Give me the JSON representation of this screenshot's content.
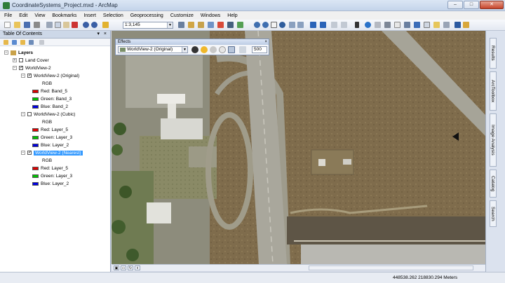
{
  "window": {
    "title": "CoordinateSystems_Project.mxd - ArcMap"
  },
  "window_controls": {
    "minimize": "–",
    "maximize": "□",
    "close": "✕"
  },
  "menu": [
    "File",
    "Edit",
    "View",
    "Bookmarks",
    "Insert",
    "Selection",
    "Geoprocessing",
    "Customize",
    "Windows",
    "Help"
  ],
  "toolbar": {
    "scale": "1:3,145",
    "dropdown_glyph": "▼"
  },
  "toc": {
    "title": "Table Of Contents",
    "header_buttons": "▾ × ",
    "tree": {
      "root": "Layers",
      "items": [
        {
          "label": "Land Cover"
        },
        {
          "label": "WorldView-2"
        }
      ],
      "sublayers": [
        {
          "label": "WorldView-2 (Original)",
          "checked": true,
          "type": "RGB",
          "bands": [
            {
              "name": "Red:",
              "value": "Band_5",
              "color": "#e00000"
            },
            {
              "name": "Green:",
              "value": "Band_3",
              "color": "#00c000"
            },
            {
              "name": "Blue:",
              "value": "Band_2",
              "color": "#0000e0"
            }
          ]
        },
        {
          "label": "WorldView-2 (Cubic)",
          "checked": false,
          "type": "RGB",
          "bands": [
            {
              "name": "Red:",
              "value": "Layer_5",
              "color": "#e00000"
            },
            {
              "name": "Green:",
              "value": "Layer_3",
              "color": "#00c000"
            },
            {
              "name": "Blue:",
              "value": "Layer_2",
              "color": "#0000e0"
            }
          ]
        },
        {
          "label": "WorldView-2 (Nearest)",
          "checked": true,
          "selected": true,
          "type": "RGB",
          "bands": [
            {
              "name": "Red:",
              "value": "Layer_5",
              "color": "#e00000"
            },
            {
              "name": "Green:",
              "value": "Layer_3",
              "color": "#00c000"
            },
            {
              "name": "Blue:",
              "value": "Layer_2",
              "color": "#0000e0"
            }
          ]
        }
      ]
    }
  },
  "effects": {
    "title": "Effects",
    "layer": "WorldView-2 (Original)",
    "flicker": "500",
    "close": "×"
  },
  "dock_tabs": [
    "Results",
    "ArcToolbox",
    "Image Analysis",
    "Catalog",
    "Search"
  ],
  "status": {
    "coords": "448538.262  218830.294 Meters"
  }
}
